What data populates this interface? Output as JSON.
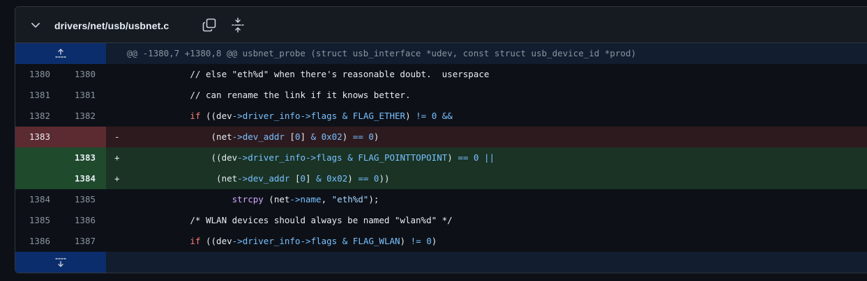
{
  "file": {
    "path": "drivers/net/usb/usbnet.c"
  },
  "hunk": {
    "header": "@@ -1380,7 +1380,8 @@ usbnet_probe (struct usb_interface *udev, const struct usb_device_id *prod)"
  },
  "lines": [
    {
      "type": "context",
      "old": "1380",
      "new": "1380",
      "marker": "",
      "tokens": [
        [
          "tx",
          "                // else \"eth%d\" when there's reasonable doubt.  userspace"
        ]
      ]
    },
    {
      "type": "context",
      "old": "1381",
      "new": "1381",
      "marker": "",
      "tokens": [
        [
          "tx",
          "                // can rename the link if it knows better."
        ]
      ]
    },
    {
      "type": "context",
      "old": "1382",
      "new": "1382",
      "marker": "",
      "tokens": [
        [
          "tx",
          "                "
        ],
        [
          "kw",
          "if"
        ],
        [
          "tx",
          " ((dev"
        ],
        [
          "op",
          "->"
        ],
        [
          "op",
          "driver_info"
        ],
        [
          "op",
          "->"
        ],
        [
          "op",
          "flags"
        ],
        [
          "tx",
          " "
        ],
        [
          "op",
          "&"
        ],
        [
          "tx",
          " "
        ],
        [
          "op",
          "FLAG_ETHER"
        ],
        [
          "tx",
          ") "
        ],
        [
          "op",
          "!="
        ],
        [
          "tx",
          " "
        ],
        [
          "op",
          "0"
        ],
        [
          "tx",
          " "
        ],
        [
          "op",
          "&&"
        ]
      ]
    },
    {
      "type": "del",
      "old": "1383",
      "new": "",
      "marker": "-",
      "tokens": [
        [
          "tx",
          "                    (net"
        ],
        [
          "op",
          "->"
        ],
        [
          "op",
          "dev_addr"
        ],
        [
          "tx",
          " ["
        ],
        [
          "op",
          "0"
        ],
        [
          "tx",
          "] "
        ],
        [
          "op",
          "&"
        ],
        [
          "tx",
          " "
        ],
        [
          "op",
          "0x02"
        ],
        [
          "tx",
          ") "
        ],
        [
          "op",
          "=="
        ],
        [
          "tx",
          " "
        ],
        [
          "op",
          "0"
        ],
        [
          "tx",
          ")"
        ]
      ]
    },
    {
      "type": "add",
      "old": "",
      "new": "1383",
      "marker": "+",
      "tokens": [
        [
          "tx",
          "                    ((dev"
        ],
        [
          "op",
          "->"
        ],
        [
          "op",
          "driver_info"
        ],
        [
          "op",
          "->"
        ],
        [
          "op",
          "flags"
        ],
        [
          "tx",
          " "
        ],
        [
          "op",
          "&"
        ],
        [
          "tx",
          " "
        ],
        [
          "op",
          "FLAG_POINTTOPOINT"
        ],
        [
          "tx",
          ") "
        ],
        [
          "op",
          "=="
        ],
        [
          "tx",
          " "
        ],
        [
          "op",
          "0"
        ],
        [
          "tx",
          " "
        ],
        [
          "op",
          "||"
        ]
      ]
    },
    {
      "type": "add",
      "old": "",
      "new": "1384",
      "marker": "+",
      "tokens": [
        [
          "tx",
          "                     (net"
        ],
        [
          "op",
          "->"
        ],
        [
          "op",
          "dev_addr"
        ],
        [
          "tx",
          " ["
        ],
        [
          "op",
          "0"
        ],
        [
          "tx",
          "] "
        ],
        [
          "op",
          "&"
        ],
        [
          "tx",
          " "
        ],
        [
          "op",
          "0x02"
        ],
        [
          "tx",
          ") "
        ],
        [
          "op",
          "=="
        ],
        [
          "tx",
          " "
        ],
        [
          "op",
          "0"
        ],
        [
          "tx",
          "))"
        ]
      ]
    },
    {
      "type": "context",
      "old": "1384",
      "new": "1385",
      "marker": "",
      "tokens": [
        [
          "tx",
          "                        "
        ],
        [
          "fn",
          "strcpy"
        ],
        [
          "tx",
          " (net"
        ],
        [
          "op",
          "->"
        ],
        [
          "op",
          "name"
        ],
        [
          "tx",
          ", "
        ],
        [
          "st",
          "\"eth%d\""
        ],
        [
          "tx",
          ");"
        ]
      ]
    },
    {
      "type": "context",
      "old": "1385",
      "new": "1386",
      "marker": "",
      "tokens": [
        [
          "tx",
          "                /* WLAN devices should always be named \"wlan%d\" */"
        ]
      ]
    },
    {
      "type": "context",
      "old": "1386",
      "new": "1387",
      "marker": "",
      "tokens": [
        [
          "tx",
          "                "
        ],
        [
          "kw",
          "if"
        ],
        [
          "tx",
          " ((dev"
        ],
        [
          "op",
          "->"
        ],
        [
          "op",
          "driver_info"
        ],
        [
          "op",
          "->"
        ],
        [
          "op",
          "flags"
        ],
        [
          "tx",
          " "
        ],
        [
          "op",
          "&"
        ],
        [
          "tx",
          " "
        ],
        [
          "op",
          "FLAG_WLAN"
        ],
        [
          "tx",
          ") "
        ],
        [
          "op",
          "!="
        ],
        [
          "tx",
          " "
        ],
        [
          "op",
          "0"
        ],
        [
          "tx",
          ")"
        ]
      ]
    }
  ],
  "colors": {
    "deletion_bg": "#2d1a1e",
    "addition_bg": "#1a3325",
    "hunk_bg": "#121d2f",
    "keyword": "#ff7b72",
    "identifier": "#79c0ff",
    "function": "#d2a8ff"
  },
  "icons": {
    "collapse": "chevron-down-icon",
    "copy": "copy-icon",
    "expand_all": "unfold-icon",
    "expand_up": "expand-up-icon",
    "expand_down": "expand-down-icon"
  }
}
